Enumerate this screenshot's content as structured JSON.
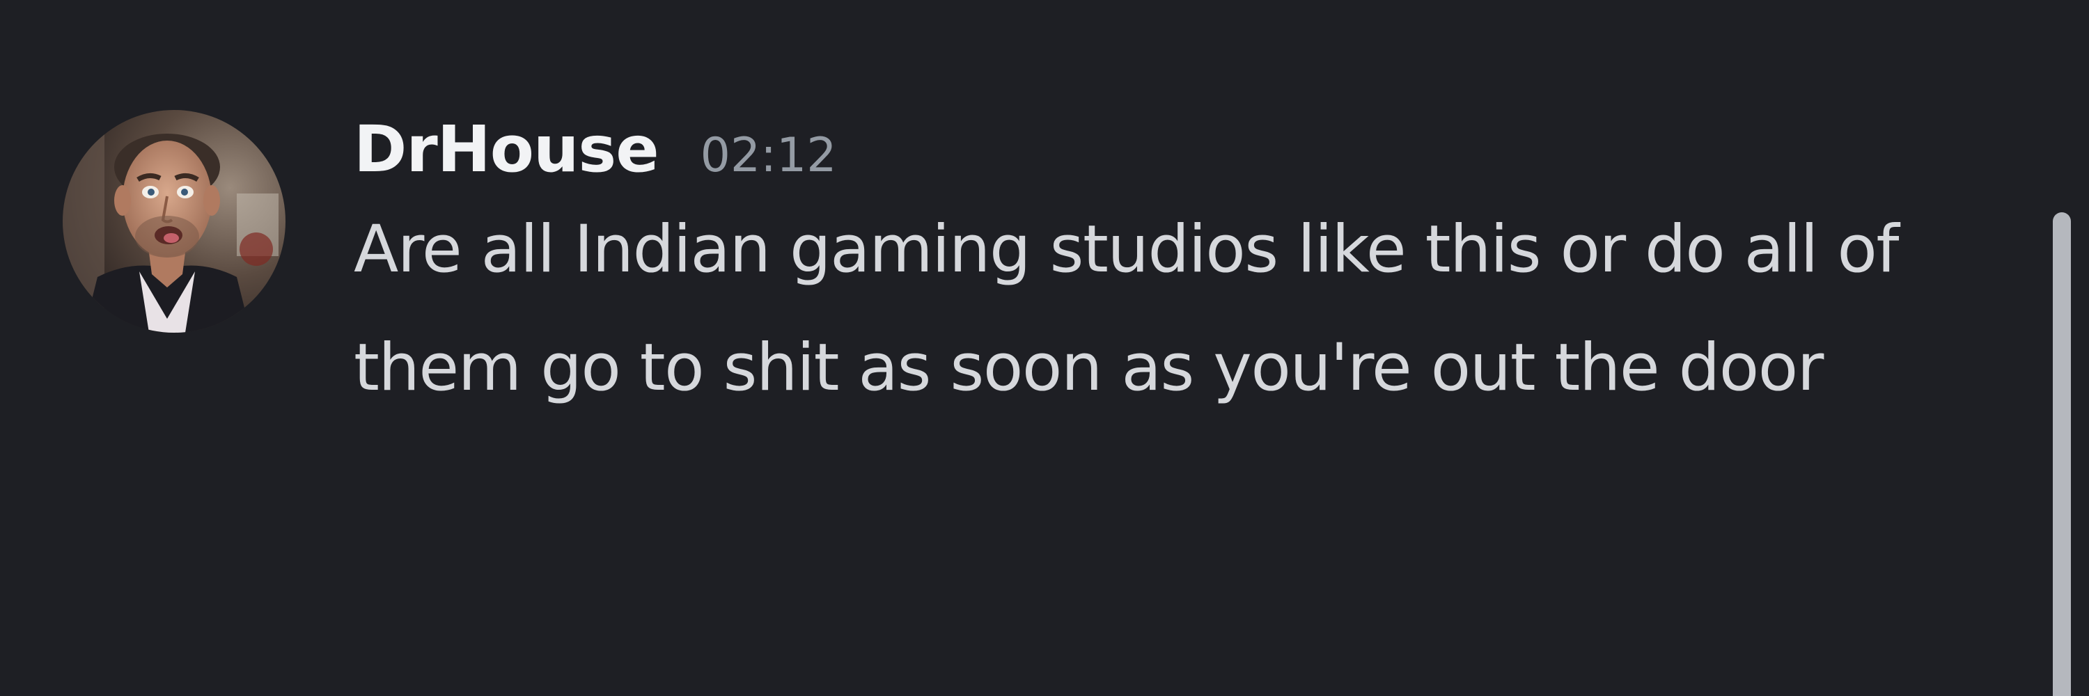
{
  "message": {
    "username": "DrHouse",
    "timestamp": "02:12",
    "content": "Are all Indian gaming studios like this or do all of them go to shit as soon as you're out the door"
  },
  "icons": {
    "avatar": "user-avatar-photo"
  },
  "colors": {
    "background": "#1e1f24",
    "username": "#f2f3f5",
    "timestamp": "#949ba4",
    "content": "#d6d8dc",
    "scrollbar": "#b5b8be"
  }
}
